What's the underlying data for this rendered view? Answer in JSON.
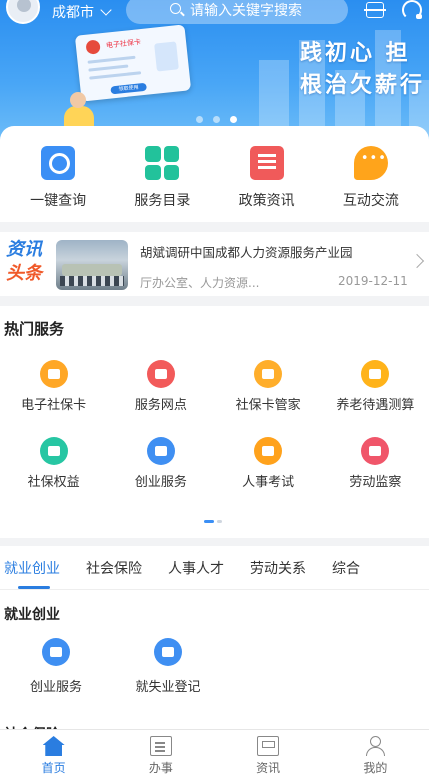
{
  "header": {
    "city": "成都市",
    "search_placeholder": "请输入关键字搜索"
  },
  "banner": {
    "card_title": "电子社保卡",
    "card_button": "领取使用",
    "slogan_line1": "践初心 担",
    "slogan_line2": "根治欠薪行",
    "slide_count": 3,
    "active_slide": 3
  },
  "quick_actions": [
    {
      "label": "一键查询",
      "icon": "search-icon"
    },
    {
      "label": "服务目录",
      "icon": "grid-icon"
    },
    {
      "label": "政策资讯",
      "icon": "news-icon"
    },
    {
      "label": "互动交流",
      "icon": "chat-icon"
    }
  ],
  "news": {
    "tag_line1": "资讯",
    "tag_line2": "头条",
    "title": "胡斌调研中国成都人力资源服务产业园",
    "source": "厅办公室、人力资源...",
    "date": "2019-12-11"
  },
  "hot_services": {
    "title": "热门服务",
    "items": [
      {
        "label": "电子社保卡",
        "color": "#ffa726",
        "icon": "card-icon"
      },
      {
        "label": "服务网点",
        "color": "#f25a5a",
        "icon": "location-icon"
      },
      {
        "label": "社保卡管家",
        "color": "#ffae2b",
        "icon": "wallet-icon"
      },
      {
        "label": "养老待遇测算",
        "color": "#ffb31a",
        "icon": "box-icon"
      },
      {
        "label": "社保权益",
        "color": "#27c6a3",
        "icon": "shield-icon"
      },
      {
        "label": "创业服务",
        "color": "#3f8ff2",
        "icon": "vase-icon"
      },
      {
        "label": "人事考试",
        "color": "#ffa21c",
        "icon": "exam-icon"
      },
      {
        "label": "劳动监察",
        "color": "#f0566a",
        "icon": "inspect-icon"
      }
    ]
  },
  "category_tabs": {
    "tabs": [
      "就业创业",
      "社会保险",
      "人事人才",
      "劳动关系",
      "综合"
    ],
    "active": 0,
    "section_title": "就业创业",
    "items": [
      {
        "label": "创业服务",
        "color": "#3f8ff2",
        "icon": "vase-icon"
      },
      {
        "label": "就失业登记",
        "color": "#3f8ff2",
        "icon": "briefcase-icon"
      }
    ],
    "next_section_title": "社会保险"
  },
  "bottom_nav": [
    {
      "label": "首页",
      "icon": "home-icon",
      "active": true
    },
    {
      "label": "办事",
      "icon": "task-icon",
      "active": false
    },
    {
      "label": "资讯",
      "icon": "newspaper-icon",
      "active": false
    },
    {
      "label": "我的",
      "icon": "user-icon",
      "active": false
    }
  ]
}
